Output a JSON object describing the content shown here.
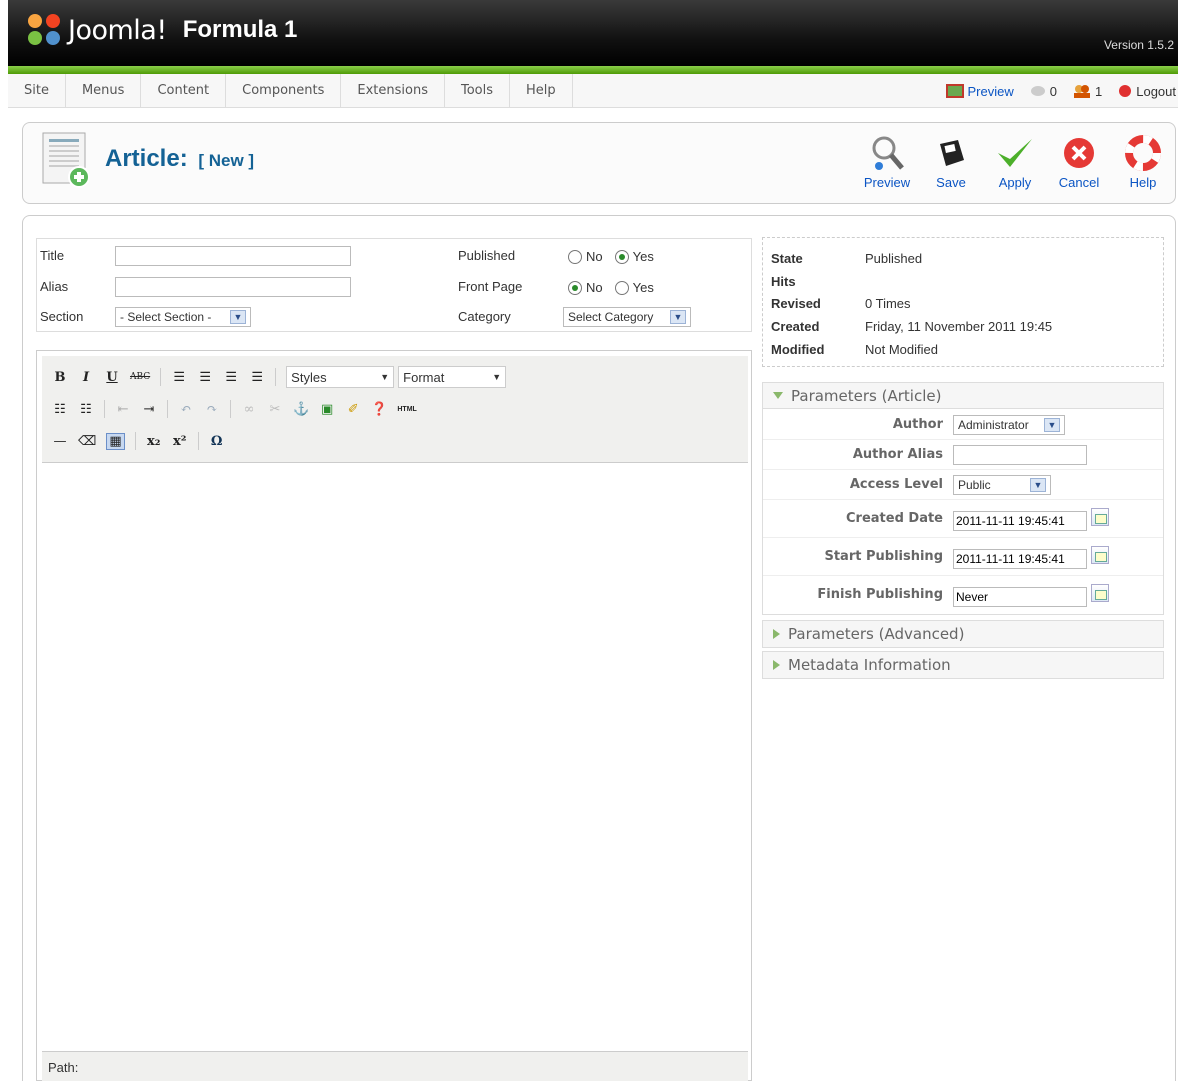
{
  "header": {
    "logo_text": "Joomla!",
    "site_name": "Formula 1",
    "version": "Version 1.5.2"
  },
  "menu": {
    "items": [
      "Site",
      "Menus",
      "Content",
      "Components",
      "Extensions",
      "Tools",
      "Help"
    ]
  },
  "status": {
    "preview": "Preview",
    "messages_count": "0",
    "users_count": "1",
    "logout": "Logout"
  },
  "page": {
    "title": "Article:",
    "subtitle": "[ New ]"
  },
  "toolbar": {
    "buttons": [
      "Preview",
      "Save",
      "Apply",
      "Cancel",
      "Help"
    ]
  },
  "form": {
    "title_label": "Title",
    "title_value": "",
    "alias_label": "Alias",
    "alias_value": "",
    "section_label": "Section",
    "section_value": "- Select Section -",
    "published_label": "Published",
    "published_no": "No",
    "published_yes": "Yes",
    "published_selected": "Yes",
    "frontpage_label": "Front Page",
    "frontpage_no": "No",
    "frontpage_yes": "Yes",
    "frontpage_selected": "No",
    "category_label": "Category",
    "category_value": "Select Category"
  },
  "editor": {
    "styles_label": "Styles",
    "format_label": "Format",
    "html_label": "HTML",
    "path_label": "Path:"
  },
  "info": {
    "state_label": "State",
    "state_value": "Published",
    "hits_label": "Hits",
    "hits_value": "",
    "revised_label": "Revised",
    "revised_value": "0 Times",
    "created_label": "Created",
    "created_value": "Friday, 11 November 2011 19:45",
    "modified_label": "Modified",
    "modified_value": "Not Modified"
  },
  "params_article": {
    "title": "Parameters (Article)",
    "author_label": "Author",
    "author_value": "Administrator",
    "author_alias_label": "Author Alias",
    "author_alias_value": "",
    "access_label": "Access Level",
    "access_value": "Public",
    "created_date_label": "Created Date",
    "created_date_value": "2011-11-11 19:45:41",
    "start_label": "Start Publishing",
    "start_value": "2011-11-11 19:45:41",
    "finish_label": "Finish Publishing",
    "finish_value": "Never"
  },
  "params_advanced": {
    "title": "Parameters (Advanced)"
  },
  "metadata": {
    "title": "Metadata Information"
  },
  "colors": {
    "title_blue": "#146295",
    "link_blue": "#0b55c4",
    "brand_green": "#4e9a06"
  }
}
